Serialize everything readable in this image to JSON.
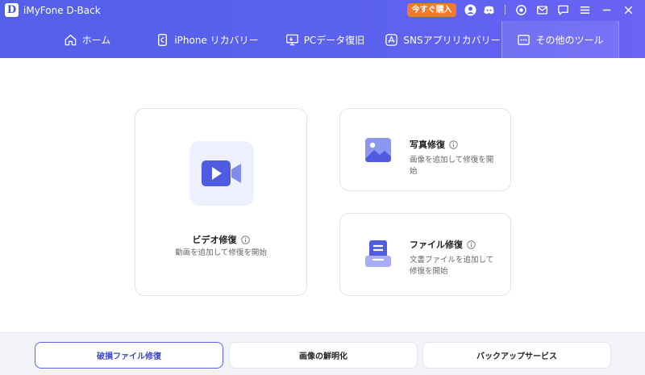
{
  "app": {
    "logo_letter": "D",
    "title": "iMyFone D-Back",
    "buy_label": "今すぐ購入"
  },
  "titlebar_icons": [
    "user-icon",
    "discord-icon",
    "target-icon",
    "mail-icon",
    "chat-icon",
    "menu-icon",
    "minimize-icon",
    "close-icon"
  ],
  "nav": {
    "tabs": [
      {
        "label": "ホーム",
        "icon": "home-icon"
      },
      {
        "label": "iPhone リカバリー",
        "icon": "phone-icon"
      },
      {
        "label": "PCデータ復旧",
        "icon": "pc-icon"
      },
      {
        "label": "SNSアプリリカバリー",
        "icon": "appstore-icon"
      },
      {
        "label": "その他のツール",
        "icon": "tools-icon",
        "active": true
      }
    ]
  },
  "cards": {
    "video": {
      "title": "ビデオ修復",
      "desc": "動画を追加して修復を開始",
      "icon": "video-icon"
    },
    "photo": {
      "title": "写真修復",
      "desc": "画像を追加して修復を開始",
      "icon": "image-icon"
    },
    "file": {
      "title": "ファイル修復",
      "desc": "文書ファイルを追加して修復を開始",
      "icon": "document-icon"
    }
  },
  "bottom_tabs": [
    {
      "label": "破損ファイル修復",
      "active": true
    },
    {
      "label": "画像の鮮明化",
      "active": false
    },
    {
      "label": "バックアップサービス",
      "active": false
    }
  ],
  "colors": {
    "accent": "#5b62ef",
    "buy": "#f07a2e",
    "icon_blue": "#4f5be0"
  }
}
